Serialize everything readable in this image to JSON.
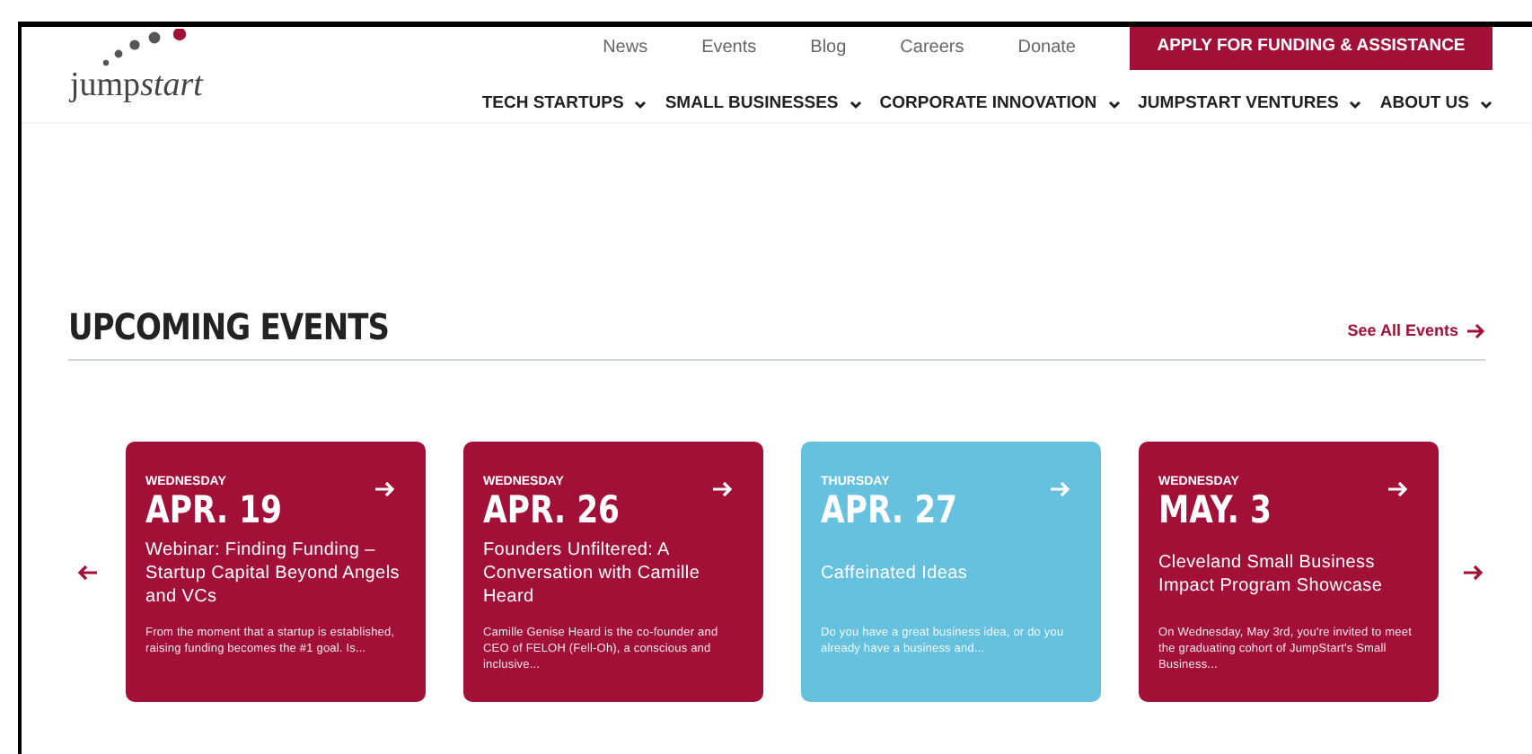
{
  "logo": {
    "text_plain": "jump",
    "text_italic": "start"
  },
  "top_links": [
    "News",
    "Events",
    "Blog",
    "Careers",
    "Donate"
  ],
  "cta_button": "APPLY FOR FUNDING & ASSISTANCE",
  "main_nav": [
    "TECH STARTUPS",
    "SMALL BUSINESSES",
    "CORPORATE INNOVATION",
    "JUMPSTART VENTURES",
    "ABOUT US"
  ],
  "section": {
    "title": "UPCOMING EVENTS",
    "link": "See All Events"
  },
  "events": [
    {
      "weekday": "WEDNESDAY",
      "date": "APR. 19",
      "title": "Webinar: Finding Funding – Startup Capital Beyond Angels and VCs",
      "excerpt": "From the moment that a startup is established, raising funding becomes the #1 goal. Is...",
      "color": "#a20f37"
    },
    {
      "weekday": "WEDNESDAY",
      "date": "APR. 26",
      "title": "Founders Unfiltered: A Conversation with Camille Heard",
      "excerpt": "Camille Genise Heard is the co-founder and CEO of FELOH (Fell-Oh), a conscious and inclusive...",
      "color": "#a20f37"
    },
    {
      "weekday": "THURSDAY",
      "date": "APR. 27",
      "title": "Caffeinated Ideas",
      "excerpt": "Do you have a great business idea, or do you already have a business and...",
      "color": "#66c1de"
    },
    {
      "weekday": "WEDNESDAY",
      "date": "MAY. 3",
      "title": "Cleveland Small Business Impact Program Showcase",
      "excerpt": "On Wednesday, May 3rd, you're invited to meet the graduating cohort of JumpStart's Small Business...",
      "color": "#a20f37"
    }
  ]
}
